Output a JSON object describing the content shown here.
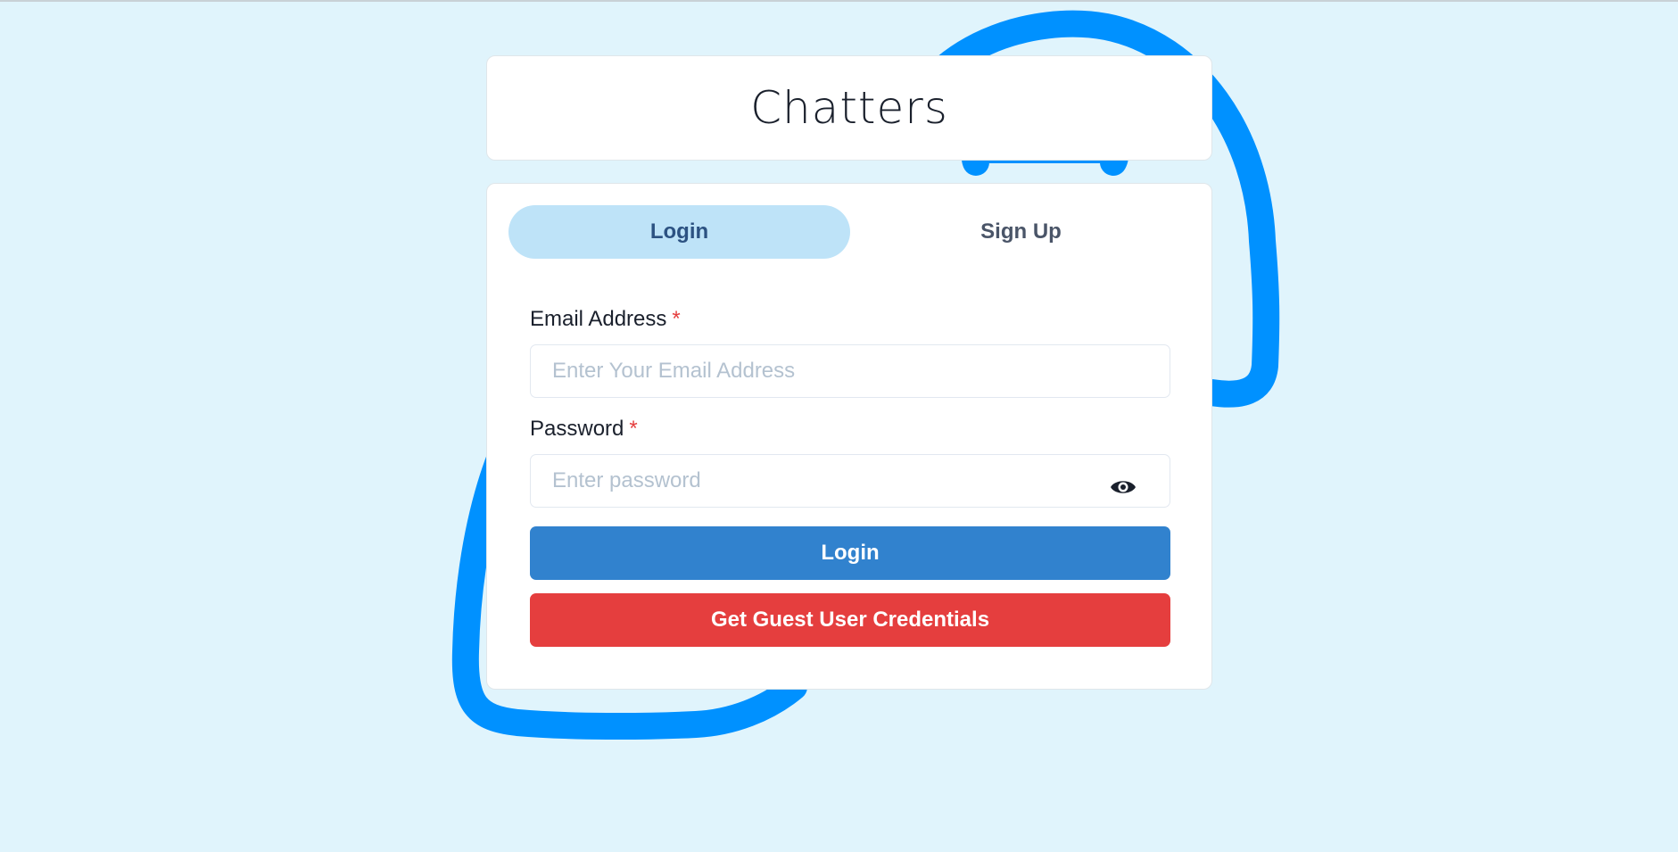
{
  "app": {
    "title": "Chatters"
  },
  "tabs": [
    {
      "label": "Login",
      "selected": true
    },
    {
      "label": "Sign Up",
      "selected": false
    }
  ],
  "form": {
    "email": {
      "label": "Email Address",
      "required_mark": "*",
      "placeholder": "Enter Your Email Address",
      "value": ""
    },
    "password": {
      "label": "Password",
      "required_mark": "*",
      "placeholder": "Enter password",
      "value": "",
      "toggle_icon": "eye-icon"
    },
    "login_button": "Login",
    "guest_button": "Get Guest User Credentials"
  },
  "colors": {
    "background": "#e0f4fc",
    "blob": "#0091ff",
    "active_tab": "#bee3f8",
    "login_button": "#3182ce",
    "guest_button": "#e53e3e",
    "required_mark": "#e53e3e"
  }
}
